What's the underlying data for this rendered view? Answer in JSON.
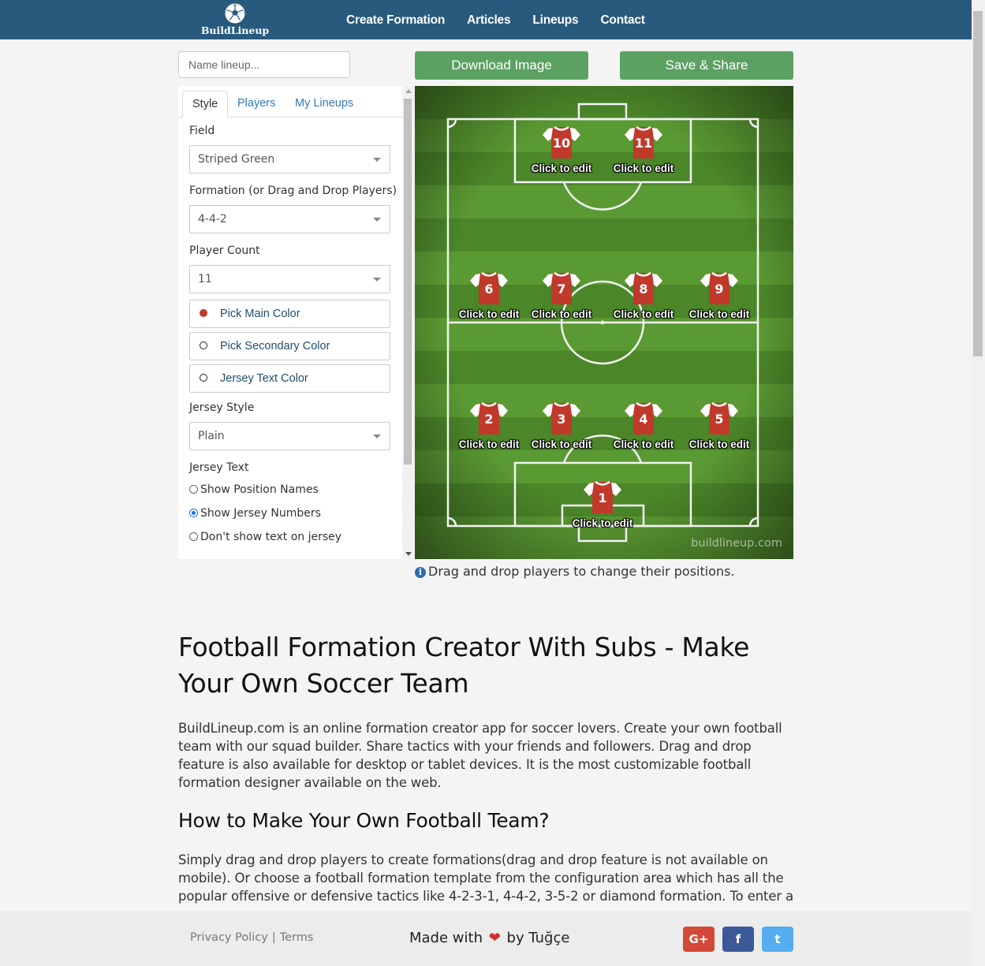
{
  "brand": {
    "name": "BuildLineup"
  },
  "nav": {
    "items": [
      "Create Formation",
      "Articles",
      "Lineups",
      "Contact"
    ]
  },
  "lineup_name": {
    "placeholder": "Name lineup..."
  },
  "actions": {
    "download_label": "Download Image",
    "save_label": "Save & Share"
  },
  "tabs": [
    {
      "label": "Style",
      "active": true
    },
    {
      "label": "Players",
      "active": false
    },
    {
      "label": "My Lineups",
      "active": false
    }
  ],
  "style": {
    "field_label": "Field",
    "field_value": "Striped Green",
    "formation_label": "Formation (or Drag and Drop Players)",
    "formation_value": "4-4-2",
    "player_count_label": "Player Count",
    "player_count_value": "11",
    "main_color_label": "Pick Main Color",
    "secondary_color_label": "Pick Secondary Color",
    "text_color_label": "Jersey Text Color",
    "jersey_style_label": "Jersey Style",
    "jersey_style_value": "Plain",
    "jersey_text_label": "Jersey Text",
    "jersey_text_options": [
      "Show Position Names",
      "Show Jersey Numbers",
      "Don't show text on jersey"
    ],
    "jersey_text_selected": "Show Jersey Numbers"
  },
  "colors": {
    "main": "#c0392b",
    "secondary": "#ffffff",
    "text": "#ffffff",
    "pitch_light": "#5f9e35",
    "pitch_dark": "#4e8a2a",
    "nav": "#275a7c",
    "button": "#5ba162"
  },
  "pitch": {
    "edit_label": "Click to edit",
    "watermark": "buildlineup.com",
    "players": [
      "1",
      "2",
      "3",
      "4",
      "5",
      "6",
      "7",
      "8",
      "9",
      "10",
      "11"
    ]
  },
  "hint": "Drag and drop players to change their positions.",
  "article": {
    "title": "Football Formation Creator With Subs - Make Your Own Soccer Team",
    "intro": "BuildLineup.com is an online formation creator app for soccer lovers. Create your own football team with our squad builder. Share tactics with your friends and followers. Drag and drop feature is also available for desktop or tablet devices. It is the most customizable football formation designer available on the web.",
    "how_title": "How to Make Your Own Football Team?",
    "how_text": "Simply drag and drop players to create formations(drag and drop feature is not available on mobile). Or choose a football formation template from the configuration area which has all the popular offensive or defensive tactics like 4-2-3-1, 4-4-2, 3-5-2 or diamond formation. To enter a"
  },
  "footer": {
    "privacy": "Privacy Policy",
    "separator": "|",
    "terms": "Terms",
    "made_with_prefix": "Made with",
    "made_with_suffix": "by Tuğçe",
    "heart_icon": "heart-icon",
    "social": [
      {
        "name": "google-plus-icon",
        "glyph": "G+",
        "color": "#d34836"
      },
      {
        "name": "facebook-icon",
        "glyph": "f",
        "color": "#3b5998"
      },
      {
        "name": "twitter-icon",
        "glyph": "t",
        "color": "#55acee"
      }
    ]
  }
}
